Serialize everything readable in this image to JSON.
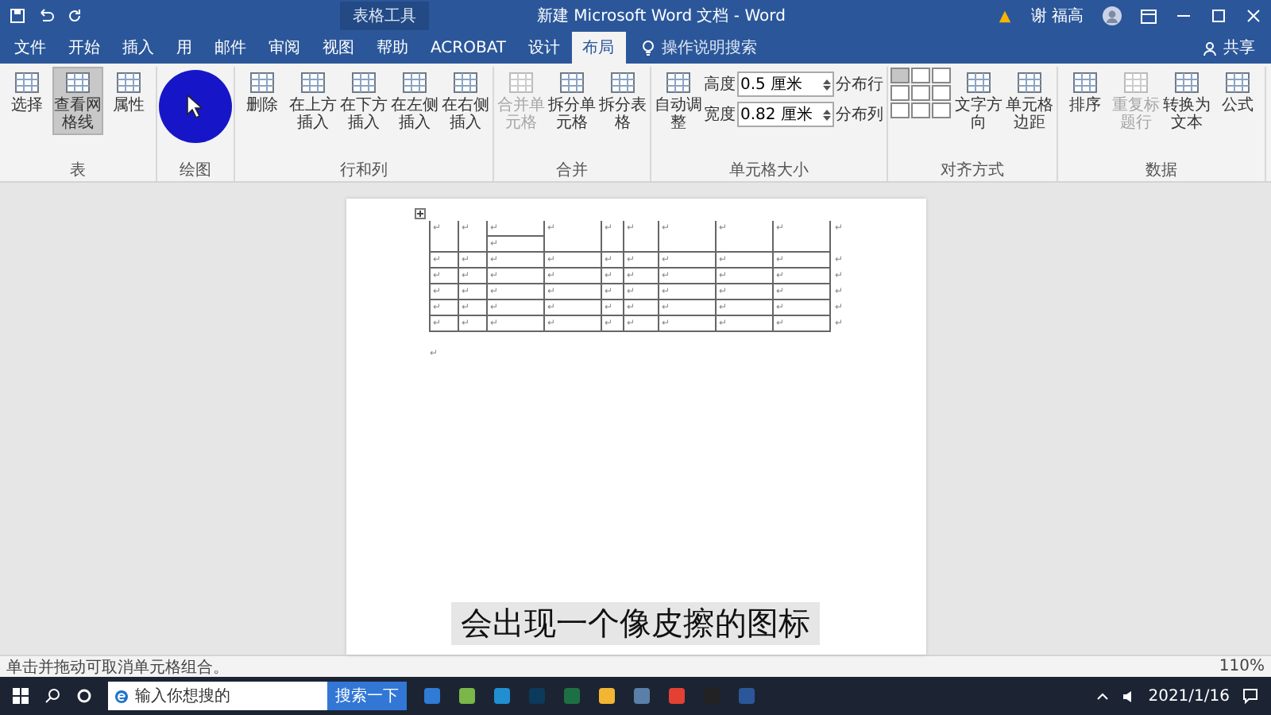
{
  "window": {
    "title": "新建 Microsoft Word 文档  -  Word",
    "context_label": "表格工具",
    "user": "谢 福高"
  },
  "tabs": [
    {
      "label": "文件",
      "selected": false
    },
    {
      "label": "开始",
      "selected": false
    },
    {
      "label": "插入",
      "selected": false
    },
    {
      "label": "用",
      "selected": false
    },
    {
      "label": "邮件",
      "selected": false
    },
    {
      "label": "审阅",
      "selected": false
    },
    {
      "label": "视图",
      "selected": false
    },
    {
      "label": "帮助",
      "selected": false
    },
    {
      "label": "ACROBAT",
      "selected": false
    },
    {
      "label": "设计",
      "selected": false
    },
    {
      "label": "布局",
      "selected": true
    }
  ],
  "tell_me": {
    "placeholder": "操作说明搜索"
  },
  "share": "共享",
  "ribbon": {
    "groups": [
      {
        "label": "表",
        "items": [
          {
            "kind": "large",
            "label": "选择",
            "selected": false,
            "disabled": false
          },
          {
            "kind": "large",
            "label": "查看网格线",
            "selected": true,
            "disabled": false
          },
          {
            "kind": "large",
            "label": "属性",
            "selected": false,
            "disabled": false
          }
        ]
      },
      {
        "label": "绘图"
      },
      {
        "label": "行和列",
        "items": [
          {
            "kind": "large",
            "label": "删除",
            "selected": false,
            "disabled": false
          },
          {
            "kind": "large",
            "label": "在上方插入",
            "selected": false,
            "disabled": false
          },
          {
            "kind": "large",
            "label": "在下方插入",
            "selected": false,
            "disabled": false
          },
          {
            "kind": "large",
            "label": "在左侧插入",
            "selected": false,
            "disabled": false
          },
          {
            "kind": "large",
            "label": "在右侧插入",
            "selected": false,
            "disabled": false
          }
        ]
      },
      {
        "label": "合并",
        "items": [
          {
            "kind": "large",
            "label": "合并单元格",
            "selected": false,
            "disabled": true
          },
          {
            "kind": "large",
            "label": "拆分单元格",
            "selected": false,
            "disabled": false
          },
          {
            "kind": "large",
            "label": "拆分表格",
            "selected": false,
            "disabled": false
          }
        ]
      },
      {
        "label": "单元格大小",
        "items": [
          {
            "kind": "large",
            "label": "自动调整",
            "selected": false,
            "disabled": false
          },
          {
            "kind": "fields",
            "label": "高度",
            "value": "0.5 厘米",
            "label2": "宽度",
            "value2": "0.82 厘米"
          },
          {
            "kind": "small",
            "label": "分布行",
            "label2": "分布列"
          }
        ]
      },
      {
        "label": "对齐方式",
        "items": [
          {
            "kind": "align"
          },
          {
            "kind": "large",
            "label": "文字方向",
            "selected": false,
            "disabled": false
          },
          {
            "kind": "large",
            "label": "单元格边距",
            "selected": false,
            "disabled": false
          }
        ]
      },
      {
        "label": "数据",
        "items": [
          {
            "kind": "large",
            "label": "排序",
            "selected": false,
            "disabled": false
          },
          {
            "kind": "large",
            "label": "重复标题行",
            "selected": false,
            "disabled": true
          },
          {
            "kind": "large",
            "label": "转换为文本",
            "selected": false,
            "disabled": false
          },
          {
            "kind": "large",
            "label": "公式",
            "selected": false,
            "disabled": false
          }
        ]
      }
    ]
  },
  "table": {
    "rows": [
      {
        "cells": [
          [
            "↵"
          ],
          [
            "↵"
          ],
          [
            "↵",
            "↵"
          ],
          [
            "↵"
          ],
          [
            "↵"
          ],
          [
            "↵"
          ],
          [
            "↵"
          ],
          [
            "↵"
          ],
          [
            "↵"
          ]
        ],
        "end_mark": "↵"
      },
      {
        "cells": [
          [
            "↵"
          ],
          [
            "↵"
          ],
          [
            "↵"
          ],
          [
            "↵"
          ],
          [
            "↵"
          ],
          [
            "↵"
          ],
          [
            "↵"
          ],
          [
            "↵"
          ],
          [
            "↵"
          ]
        ],
        "end_mark": "↵"
      },
      {
        "cells": [
          [
            "↵"
          ],
          [
            "↵"
          ],
          [
            "↵"
          ],
          [
            "↵"
          ],
          [
            "↵"
          ],
          [
            "↵"
          ],
          [
            "↵"
          ],
          [
            "↵"
          ],
          [
            "↵"
          ]
        ],
        "end_mark": "↵"
      },
      {
        "cells": [
          [
            "↵"
          ],
          [
            "↵"
          ],
          [
            "↵"
          ],
          [
            "↵"
          ],
          [
            "↵"
          ],
          [
            "↵"
          ],
          [
            "↵"
          ],
          [
            "↵"
          ],
          [
            "↵"
          ]
        ],
        "end_mark": "↵"
      },
      {
        "cells": [
          [
            "↵"
          ],
          [
            "↵"
          ],
          [
            "↵"
          ],
          [
            "↵"
          ],
          [
            "↵"
          ],
          [
            "↵"
          ],
          [
            "↵"
          ],
          [
            "↵"
          ],
          [
            "↵"
          ]
        ],
        "end_mark": "↵"
      },
      {
        "cells": [
          [
            "↵"
          ],
          [
            "↵"
          ],
          [
            "↵"
          ],
          [
            "↵"
          ],
          [
            "↵"
          ],
          [
            "↵"
          ],
          [
            "↵"
          ],
          [
            "↵"
          ],
          [
            "↵"
          ]
        ],
        "end_mark": "↵"
      }
    ],
    "after_mark": "↵"
  },
  "subtitle": "会出现一个像皮擦的图标",
  "status_bar": {
    "message": "单击并拖动可取消单元格组合。",
    "zoom": "110%"
  },
  "taskbar": {
    "search": {
      "placeholder": "输入你想搜的"
    },
    "search_button": "搜索一下",
    "date": "2021/1/16"
  }
}
